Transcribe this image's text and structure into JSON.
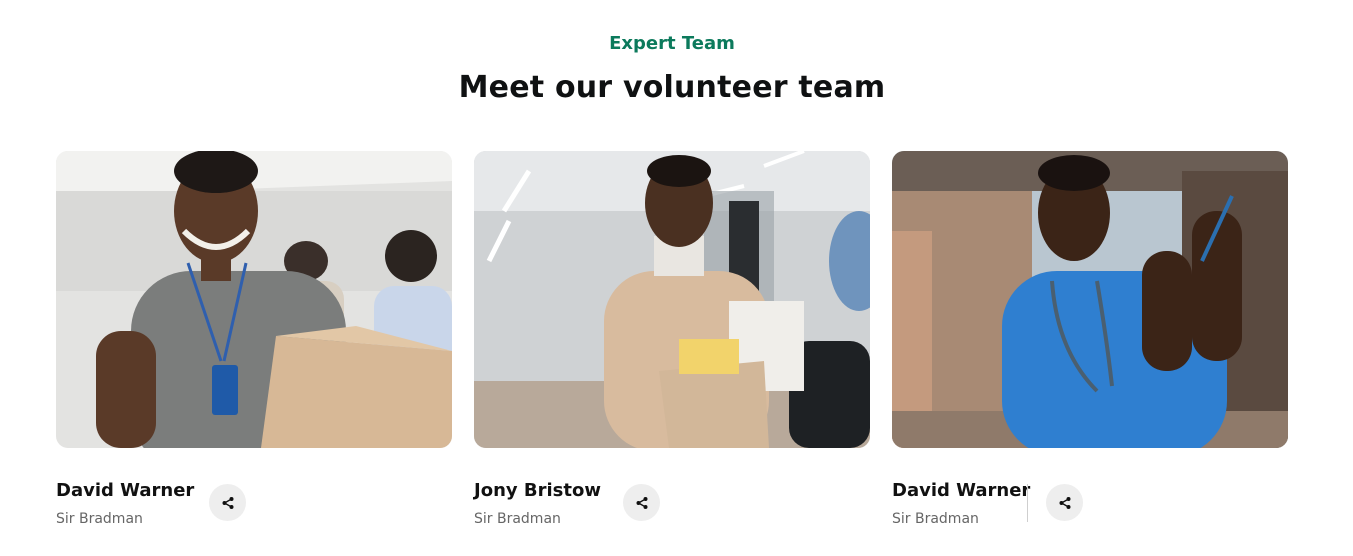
{
  "section": {
    "eyebrow": "Expert Team",
    "title": "Meet our volunteer team"
  },
  "members": [
    {
      "name": "David Warner",
      "role": "Sir Bradman",
      "photo": "volunteer-holding-box"
    },
    {
      "name": "Jony Bristow",
      "role": "Sir Bradman",
      "photo": "man-carrying-office-box"
    },
    {
      "name": "David Warner",
      "role": "Sir Bradman",
      "photo": "doctor-holding-syringe"
    }
  ],
  "icons": {
    "share": "share-icon"
  },
  "colors": {
    "accent": "#0c7a5c",
    "heading": "#0f1112",
    "share_bg": "#eeeeee"
  }
}
